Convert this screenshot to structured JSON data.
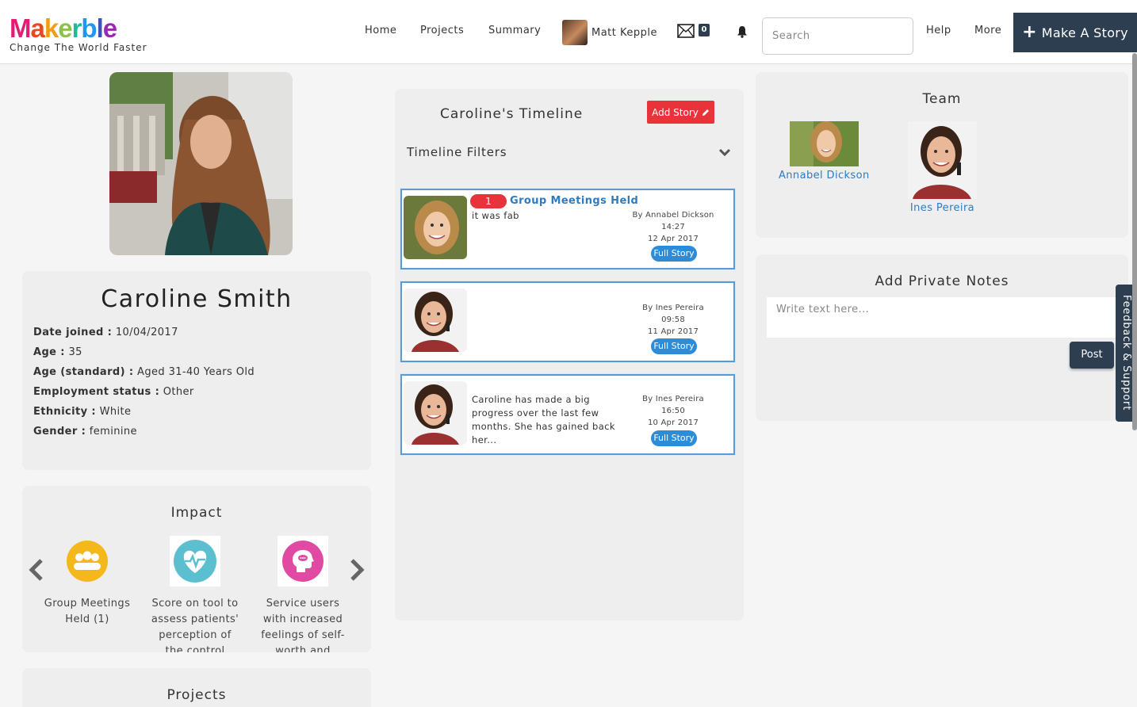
{
  "brand": {
    "logo_letters": [
      "M",
      "a",
      "k",
      "e",
      "r",
      "b",
      "l",
      "e"
    ],
    "logo_colors": [
      "#e11d74",
      "#e84a1e",
      "#f39c12",
      "#8bc34a",
      "#1abc9c",
      "#2196f3",
      "#3f51b5",
      "#9c27b0"
    ],
    "tagline": "Change The World Faster"
  },
  "nav": {
    "home": "Home",
    "projects": "Projects",
    "summary": "Summary",
    "user_name": "Matt Kepple",
    "mail_count": "0",
    "search_placeholder": "Search",
    "help": "Help",
    "more": "More",
    "make_story": "Make A Story"
  },
  "profile": {
    "name": "Caroline Smith",
    "fields": [
      {
        "label": "Date joined :",
        "value": "10/04/2017"
      },
      {
        "label": "Age :",
        "value": "35"
      },
      {
        "label": "Age (standard) :",
        "value": "Aged 31-40 Years Old"
      },
      {
        "label": "Employment status :",
        "value": "Other"
      },
      {
        "label": "Ethnicity :",
        "value": "White"
      },
      {
        "label": "Gender :",
        "value": "feminine"
      }
    ]
  },
  "impact": {
    "title": "Impact",
    "items": [
      {
        "label": "Group Meetings Held (1)",
        "icon": "group-icon",
        "color": "#f5b81c"
      },
      {
        "label": "Score on tool to assess patients' perception of the control",
        "icon": "heart-pulse-icon",
        "color": "#5bbfcf"
      },
      {
        "label": "Service users with increased feelings of self-worth and improved self-",
        "icon": "head-chat-icon",
        "color": "#e04aa2"
      }
    ]
  },
  "projects": {
    "title": "Projects"
  },
  "timeline": {
    "title": "Caroline's Timeline",
    "add_story": "Add Story",
    "filters": "Timeline Filters",
    "stories": [
      {
        "count": "1",
        "title": "Group Meetings Held",
        "text": "it was fab",
        "author": "By Annabel Dickson",
        "time": "14:27",
        "date": "12 Apr 2017",
        "button": "Full Story"
      },
      {
        "count": "",
        "title": "",
        "text": "",
        "author": "By Ines Pereira",
        "time": "09:58",
        "date": "11 Apr 2017",
        "button": "Full Story"
      },
      {
        "count": "",
        "title": "",
        "text": "Caroline has made a big progress over the last few months. She has gained back her...",
        "author": "By Ines Pereira",
        "time": "16:50",
        "date": "10 Apr 2017",
        "button": "Full Story"
      }
    ]
  },
  "team": {
    "title": "Team",
    "members": [
      {
        "name": "Annabel Dickson"
      },
      {
        "name": "Ines Pereira"
      }
    ]
  },
  "notes": {
    "title": "Add Private Notes",
    "placeholder": "Write text here...",
    "post": "Post"
  },
  "feedback": "Feedback & Support"
}
